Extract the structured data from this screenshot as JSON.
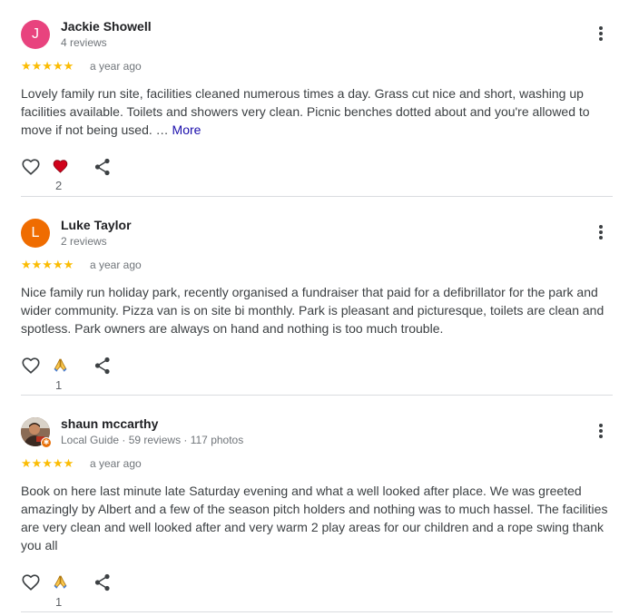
{
  "reviews": [
    {
      "avatar_letter": "J",
      "avatar_color": "#e8437e",
      "name": "Jackie Showell",
      "meta": "4 reviews",
      "stars": "★★★★★",
      "rating": 5,
      "date": "a year ago",
      "text": "Lovely family run site, facilities cleaned numerous times a day. Grass cut nice and short, washing up facilities available. Toilets and showers very clean. Picnic benches dotted about and you're allowed to move if not being used. …",
      "more_label": "More",
      "reaction_icon": "red-heart-icon",
      "reaction_count": "2"
    },
    {
      "avatar_letter": "L",
      "avatar_color": "#ef6c00",
      "name": "Luke Taylor",
      "meta": "2 reviews",
      "stars": "★★★★★",
      "rating": 5,
      "date": "a year ago",
      "text": "Nice family run holiday park, recently organised a fundraiser that paid for a defibrillator for the park and wider community. Pizza van is on site bi monthly. Park is pleasant and picturesque, toilets are clean and spotless. Park owners are always on hand and nothing is too much trouble.",
      "reaction_icon": "praying-hands-icon",
      "reaction_count": "1"
    },
    {
      "name": "shaun mccarthy",
      "meta": "Local Guide · 59 reviews · 117 photos",
      "stars": "★★★★★",
      "rating": 5,
      "date": "a year ago",
      "text": "Book on here last minute late Saturday evening and what a well looked after place. We was greeted amazingly by Albert and a few of the season pitch holders and nothing was to much hassel. The facilities are very clean and well looked after and very warm 2 play areas for our children and a rope swing thank you all",
      "reaction_icon": "praying-hands-icon",
      "reaction_count": "1"
    }
  ],
  "colors": {
    "star": "#fbbc04",
    "more_link": "#1a0dab",
    "divider": "#dadce0"
  }
}
